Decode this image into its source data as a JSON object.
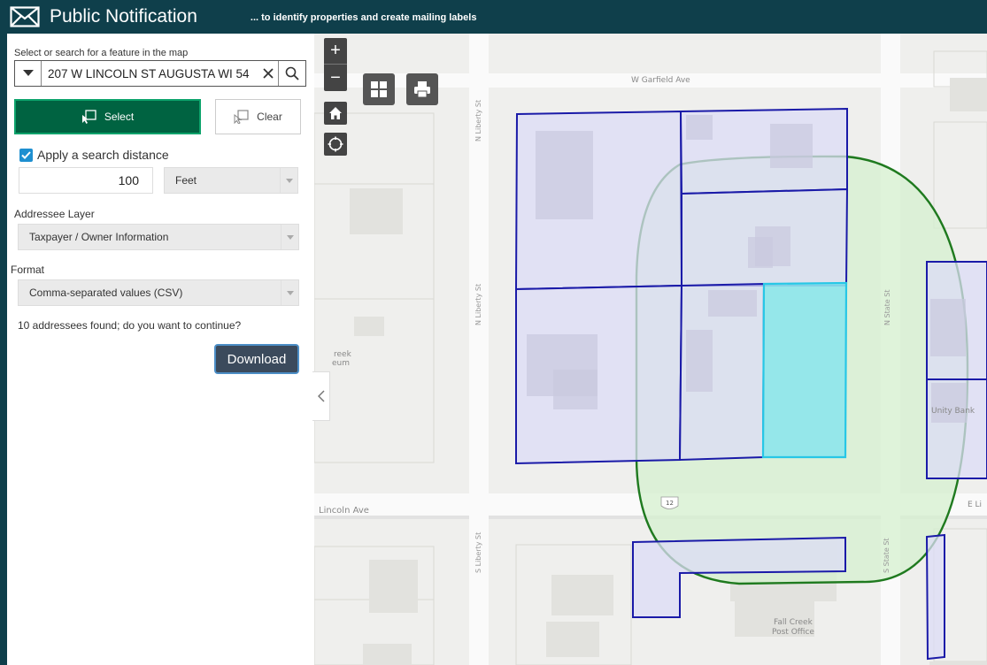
{
  "header": {
    "title": "Public Notification",
    "subtitle": "... to identify properties and create mailing labels"
  },
  "panel": {
    "search_label": "Select or search for a feature in the map",
    "search_value": "207 W LINCOLN ST AUGUSTA WI 54",
    "select_label": "Select",
    "clear_label": "Clear",
    "apply_distance_label": "Apply a search distance",
    "apply_distance_checked": true,
    "distance_value": "100",
    "distance_unit": "Feet",
    "addressee_layer_label": "Addressee Layer",
    "addressee_layer_value": "Taxpayer / Owner Information",
    "format_label": "Format",
    "format_value": "Comma-separated values (CSV)",
    "found_message": "10 addressees found; do you want to continue?",
    "download_label": "Download"
  },
  "map": {
    "streets": {
      "w_garfield": "W Garfield Ave",
      "n_liberty_top": "N Liberty St",
      "n_liberty_mid": "N Liberty St",
      "s_liberty": "S Liberty St",
      "n_state": "N State St",
      "s_state": "S State St",
      "lincoln": "Lincoln Ave",
      "e_lincoln": "E Li"
    },
    "labels": {
      "unity_bank": "Unity Bank",
      "fall_creek_po_1": "Fall Creek",
      "fall_creek_po_2": "Post Office",
      "creek_museum_1": "reek",
      "creek_museum_2": "eum",
      "route_shield": "12"
    },
    "colors": {
      "parcel_outline": "#1a1aa8",
      "parcel_fill": "#dcdcf5",
      "selected_fill": "#8de6ec",
      "selected_outline": "#27c7e6",
      "buffer_outline": "#1f7a1f",
      "buffer_fill": "#d6f0cf"
    }
  },
  "colors": {
    "header_bg": "#0f3f4b",
    "select_button": "#006341",
    "download_button": "#3b4a5c",
    "checkbox": "#1e8fd0"
  }
}
